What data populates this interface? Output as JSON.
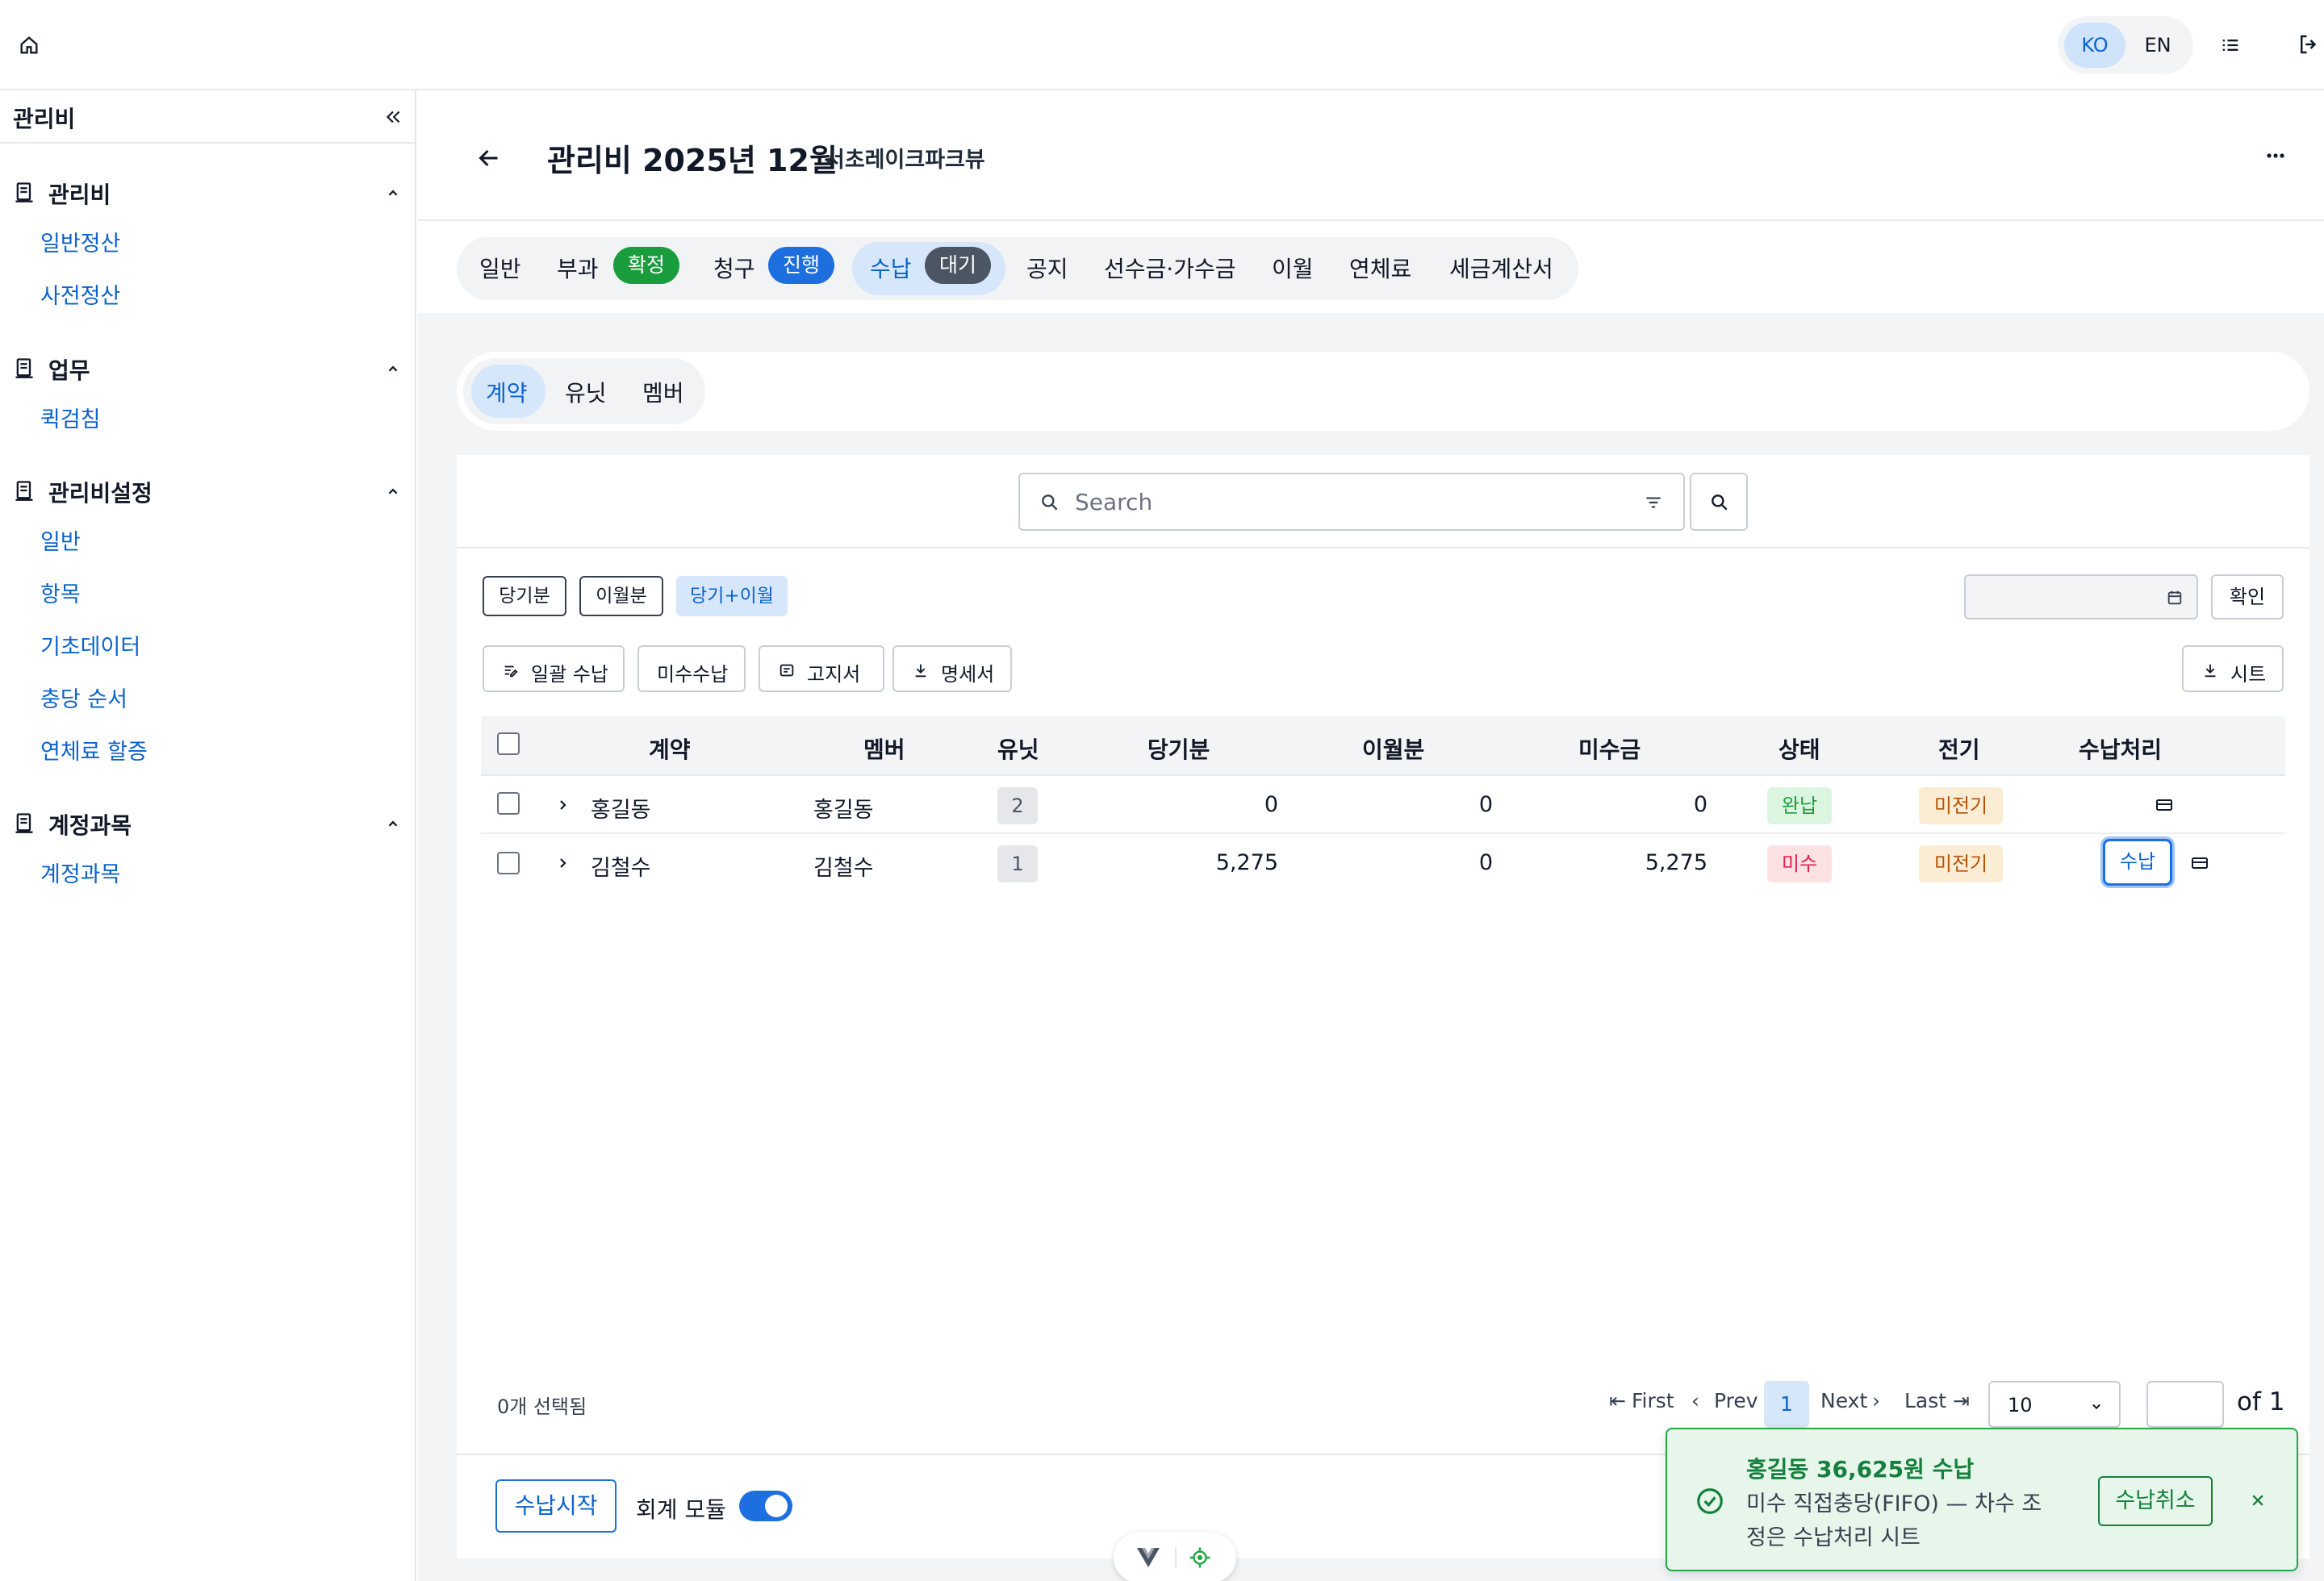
{
  "lang": {
    "ko": "KO",
    "en": "EN"
  },
  "sidebar": {
    "title": "관리비",
    "groups": [
      {
        "label": "관리비",
        "items": [
          "일반정산",
          "사전정산"
        ]
      },
      {
        "label": "업무",
        "items": [
          "퀵검침"
        ]
      },
      {
        "label": "관리비설정",
        "items": [
          "일반",
          "항목",
          "기초데이터",
          "충당 순서",
          "연체료 할증"
        ]
      },
      {
        "label": "계정과목",
        "items": [
          "계정과목"
        ]
      }
    ]
  },
  "header": {
    "title": "관리비 2025년 12월",
    "subtitle": "서초레이크파크뷰"
  },
  "tabs": [
    {
      "label": "일반"
    },
    {
      "label": "부과",
      "badge": "확정"
    },
    {
      "label": "청구",
      "badge": "진행"
    },
    {
      "label": "수납",
      "badge": "대기"
    },
    {
      "label": "공지"
    },
    {
      "label": "선수금·가수금"
    },
    {
      "label": "이월"
    },
    {
      "label": "연체료"
    },
    {
      "label": "세금계산서"
    }
  ],
  "subtabs": [
    "계약",
    "유닛",
    "멤버"
  ],
  "search": {
    "placeholder": "Search"
  },
  "filters": {
    "current": "당기분",
    "carried": "이월분",
    "both": "당기+이월"
  },
  "confirm_label": "확인",
  "actions": {
    "bulk_pay": "일괄 수납",
    "unpaid_pay": "미수수납",
    "notice": "고지서",
    "statement": "명세서",
    "sheet": "시트"
  },
  "table": {
    "headers": [
      "계약",
      "멤버",
      "유닛",
      "당기분",
      "이월분",
      "미수금",
      "상태",
      "전기",
      "수납처리"
    ],
    "rows": [
      {
        "contract": "홍길동",
        "member": "홍길동",
        "unit": "2",
        "current": "0",
        "carried": "0",
        "unpaid": "0",
        "status": "완납",
        "posting": "미전기"
      },
      {
        "contract": "김철수",
        "member": "김철수",
        "unit": "1",
        "current": "5,275",
        "carried": "0",
        "unpaid": "5,275",
        "status": "미수",
        "posting": "미전기",
        "action": "수납"
      }
    ]
  },
  "footer": {
    "selected": "0개 선택됨",
    "start": "수납시작",
    "accounting": "회계 모듈",
    "accounting_on": true
  },
  "pagination": {
    "first": "First",
    "prev": "Prev",
    "current": "1",
    "next": "Next",
    "last": "Last",
    "page_size": "10",
    "of": "of 1"
  },
  "toast": {
    "title": "홍길동 36,625원 수납",
    "message": "미수 직접충당(FIFO) — 차수 조정은 수납처리 시트",
    "undo": "수납취소"
  },
  "colors": {
    "accent": "#1d6fe0",
    "success": "#1a9d3c",
    "danger": "#e11d48",
    "warning": "#b45309",
    "badge_gray": "#4b5563"
  }
}
